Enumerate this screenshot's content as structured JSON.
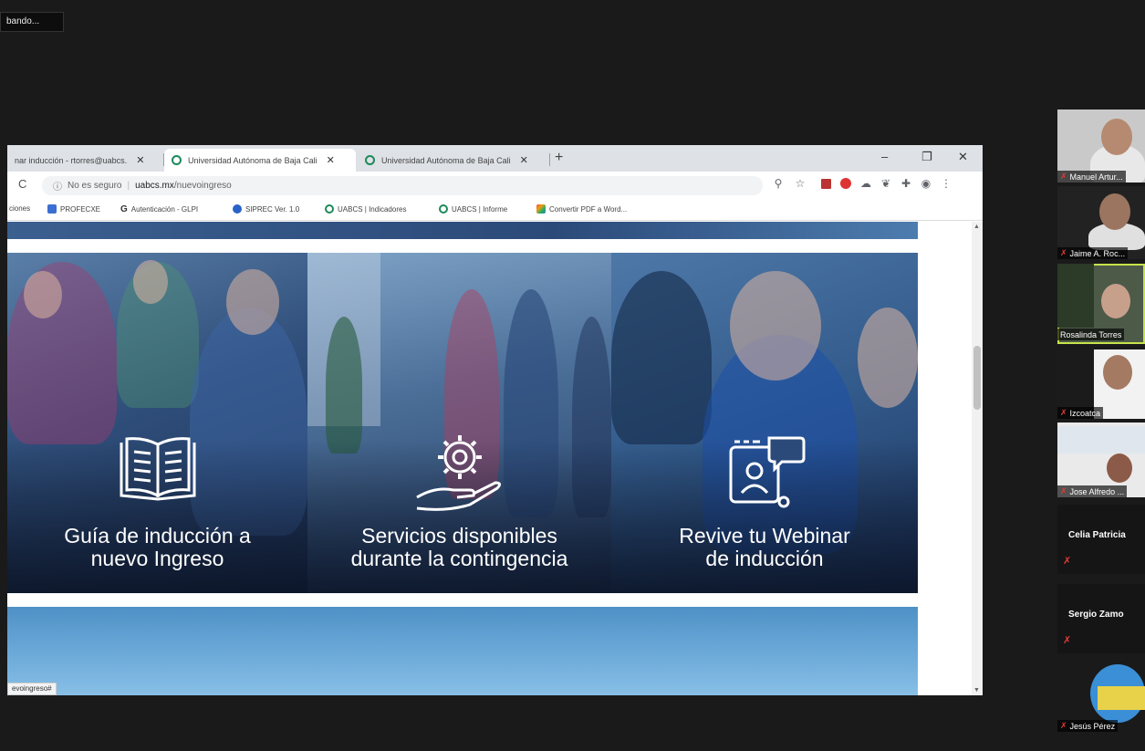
{
  "meeting": {
    "status_text": "bando..."
  },
  "browser": {
    "tabs": [
      {
        "label": "nar inducción - rtorres@uabcs.",
        "active": false
      },
      {
        "label": "Universidad Autónoma de Baja Cali",
        "active": true
      },
      {
        "label": "Universidad Autónoma de Baja Cali",
        "active": false
      }
    ],
    "new_tab": "+",
    "window_controls": {
      "minimize": "–",
      "restore": "❐",
      "close": "✕"
    },
    "address": {
      "security": "No es seguro",
      "host": "uabcs.mx",
      "path": "/nuevoingreso"
    },
    "extensions": [
      "zoom-icon",
      "star-icon",
      "pdf-icon",
      "extension-icon",
      "cloud-icon",
      "evernote-icon",
      "puzzle-icon",
      "profile-icon",
      "menu-icon"
    ],
    "bookmarks": [
      {
        "label": "ciones",
        "color": "#ffffff"
      },
      {
        "label": "PROFECXE",
        "color": "#3b6fd1"
      },
      {
        "label": "Autenticación - GLPI",
        "color": "#333333"
      },
      {
        "label": "SIPREC Ver. 1.0",
        "color": "#2a62c9"
      },
      {
        "label": "UABCS | Indicadores",
        "color": "#1d8a5a"
      },
      {
        "label": "UABCS | Informe",
        "color": "#1d8a5a"
      },
      {
        "label": "Convertir PDF a Word...",
        "color": "#e84c3d"
      }
    ],
    "status_url": "evoingreso#"
  },
  "page": {
    "panels": [
      {
        "title_line1": "Guía de inducción a",
        "title_line2": "nuevo Ingreso",
        "icon": "open-book-icon"
      },
      {
        "title_line1": "Servicios  disponibles",
        "title_line2": "durante la contingencia",
        "icon": "gear-hand-icon"
      },
      {
        "title_line1": "Revive tu Webinar",
        "title_line2": "de inducción",
        "icon": "video-chat-icon"
      }
    ]
  },
  "participants": [
    {
      "name": "Manuel Artur...",
      "type": "video",
      "muted": true
    },
    {
      "name": "Jaime A. Roc...",
      "type": "video",
      "muted": true
    },
    {
      "name": "Rosalinda Torres",
      "type": "video",
      "muted": false,
      "speaking": true
    },
    {
      "name": "Izcoatca",
      "type": "video",
      "muted": true
    },
    {
      "name": "Jose Alfredo ...",
      "type": "video",
      "muted": true
    },
    {
      "name": "Celia Patricia",
      "type": "text",
      "muted": true
    },
    {
      "name": "Sergio Zamo",
      "type": "text",
      "muted": true
    },
    {
      "name": "Jesús Pérez",
      "type": "video",
      "muted": true
    }
  ],
  "colors": {
    "meeting_bg": "#1a1a1a",
    "speaking_outline": "#c6e34a",
    "muted_red": "#e23a3a"
  }
}
